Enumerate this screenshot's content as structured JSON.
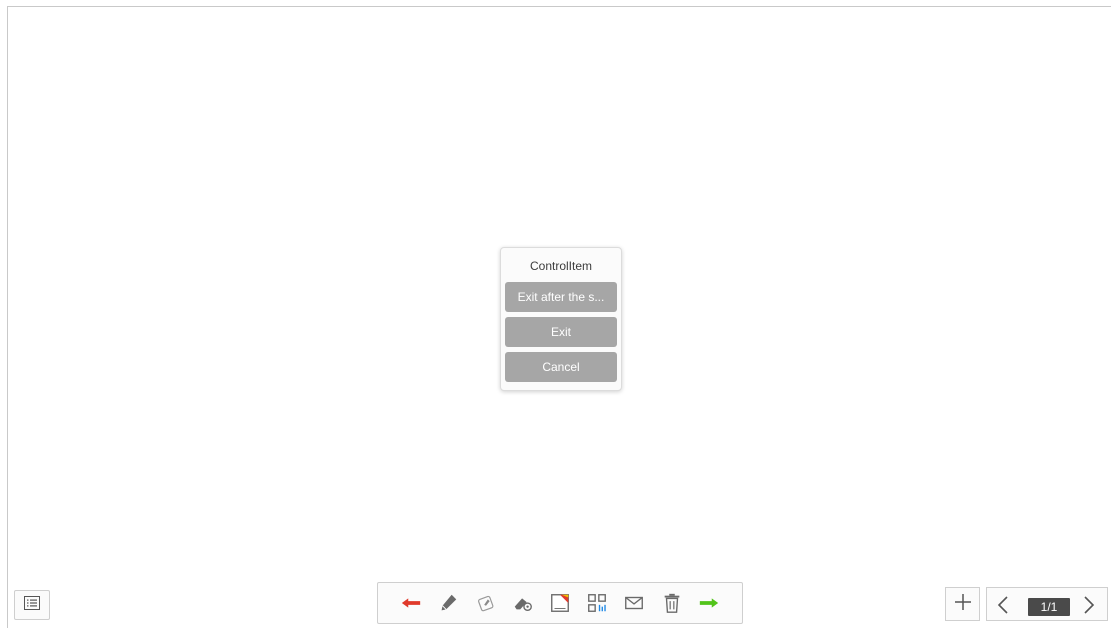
{
  "dialog": {
    "title": "ControlItem",
    "buttons": [
      {
        "label": "Exit after the s..."
      },
      {
        "label": "Exit"
      },
      {
        "label": "Cancel"
      }
    ]
  },
  "toolbar": {
    "tools": [
      {
        "icon": "undo-arrow-icon",
        "color": "#e03a2b"
      },
      {
        "icon": "pen-icon"
      },
      {
        "icon": "highlighter-icon"
      },
      {
        "icon": "eraser-settings-icon"
      },
      {
        "icon": "background-color-icon"
      },
      {
        "icon": "qr-code-icon"
      },
      {
        "icon": "mail-icon"
      },
      {
        "icon": "trash-icon"
      },
      {
        "icon": "redo-arrow-icon",
        "color": "#52c41a"
      }
    ]
  },
  "pager": {
    "page_indicator": "1/1"
  },
  "icons": {
    "list": "list-icon",
    "add": "plus-icon",
    "prev": "chevron-left-icon",
    "next": "chevron-right-icon"
  }
}
